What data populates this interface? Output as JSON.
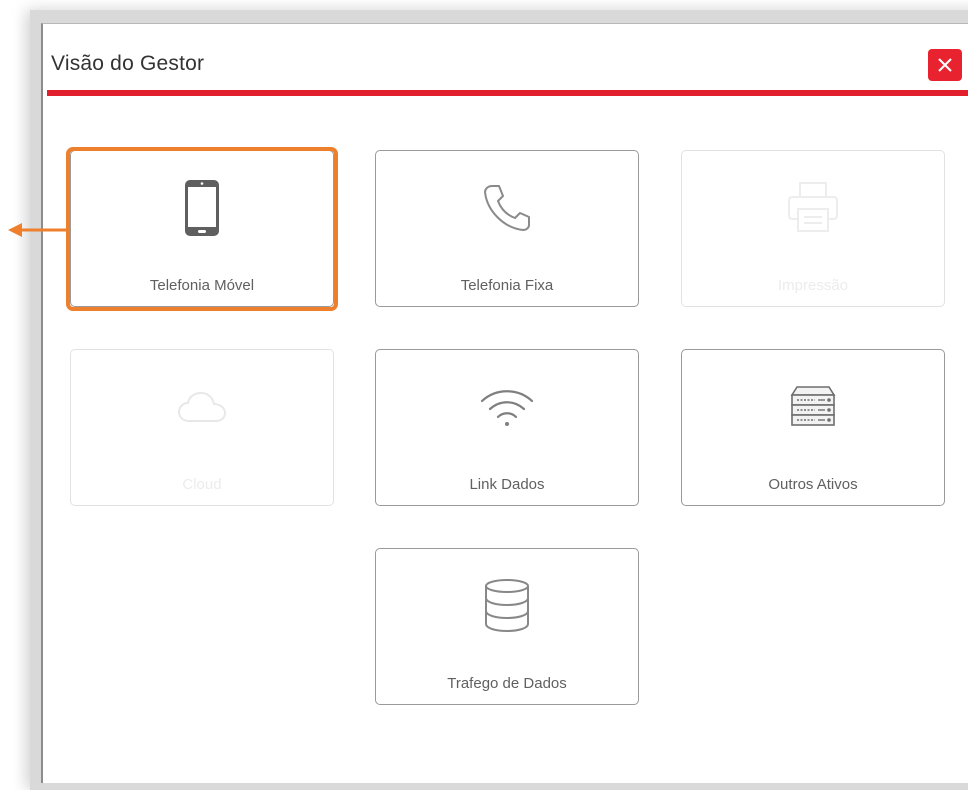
{
  "dialog": {
    "title": "Visão do Gestor",
    "close_icon": "close-x-icon"
  },
  "colors": {
    "accent_red": "#e21f2c",
    "highlight_orange": "#ee7f2c",
    "tile_border": "#9a9a9a",
    "disabled_text": "#ececec"
  },
  "tiles": [
    {
      "label": "Telefonia Móvel",
      "icon": "mobile-phone-icon",
      "enabled": true,
      "highlighted": true
    },
    {
      "label": "Telefonia Fixa",
      "icon": "phone-handset-icon",
      "enabled": true
    },
    {
      "label": "Impressão",
      "icon": "printer-icon",
      "enabled": false
    },
    {
      "label": "Cloud",
      "icon": "cloud-icon",
      "enabled": false
    },
    {
      "label": "Link Dados",
      "icon": "wifi-icon",
      "enabled": true
    },
    {
      "label": "Outros Ativos",
      "icon": "server-rack-icon",
      "enabled": true
    },
    {
      "label": "Trafego de Dados",
      "icon": "database-icon",
      "enabled": true
    }
  ]
}
